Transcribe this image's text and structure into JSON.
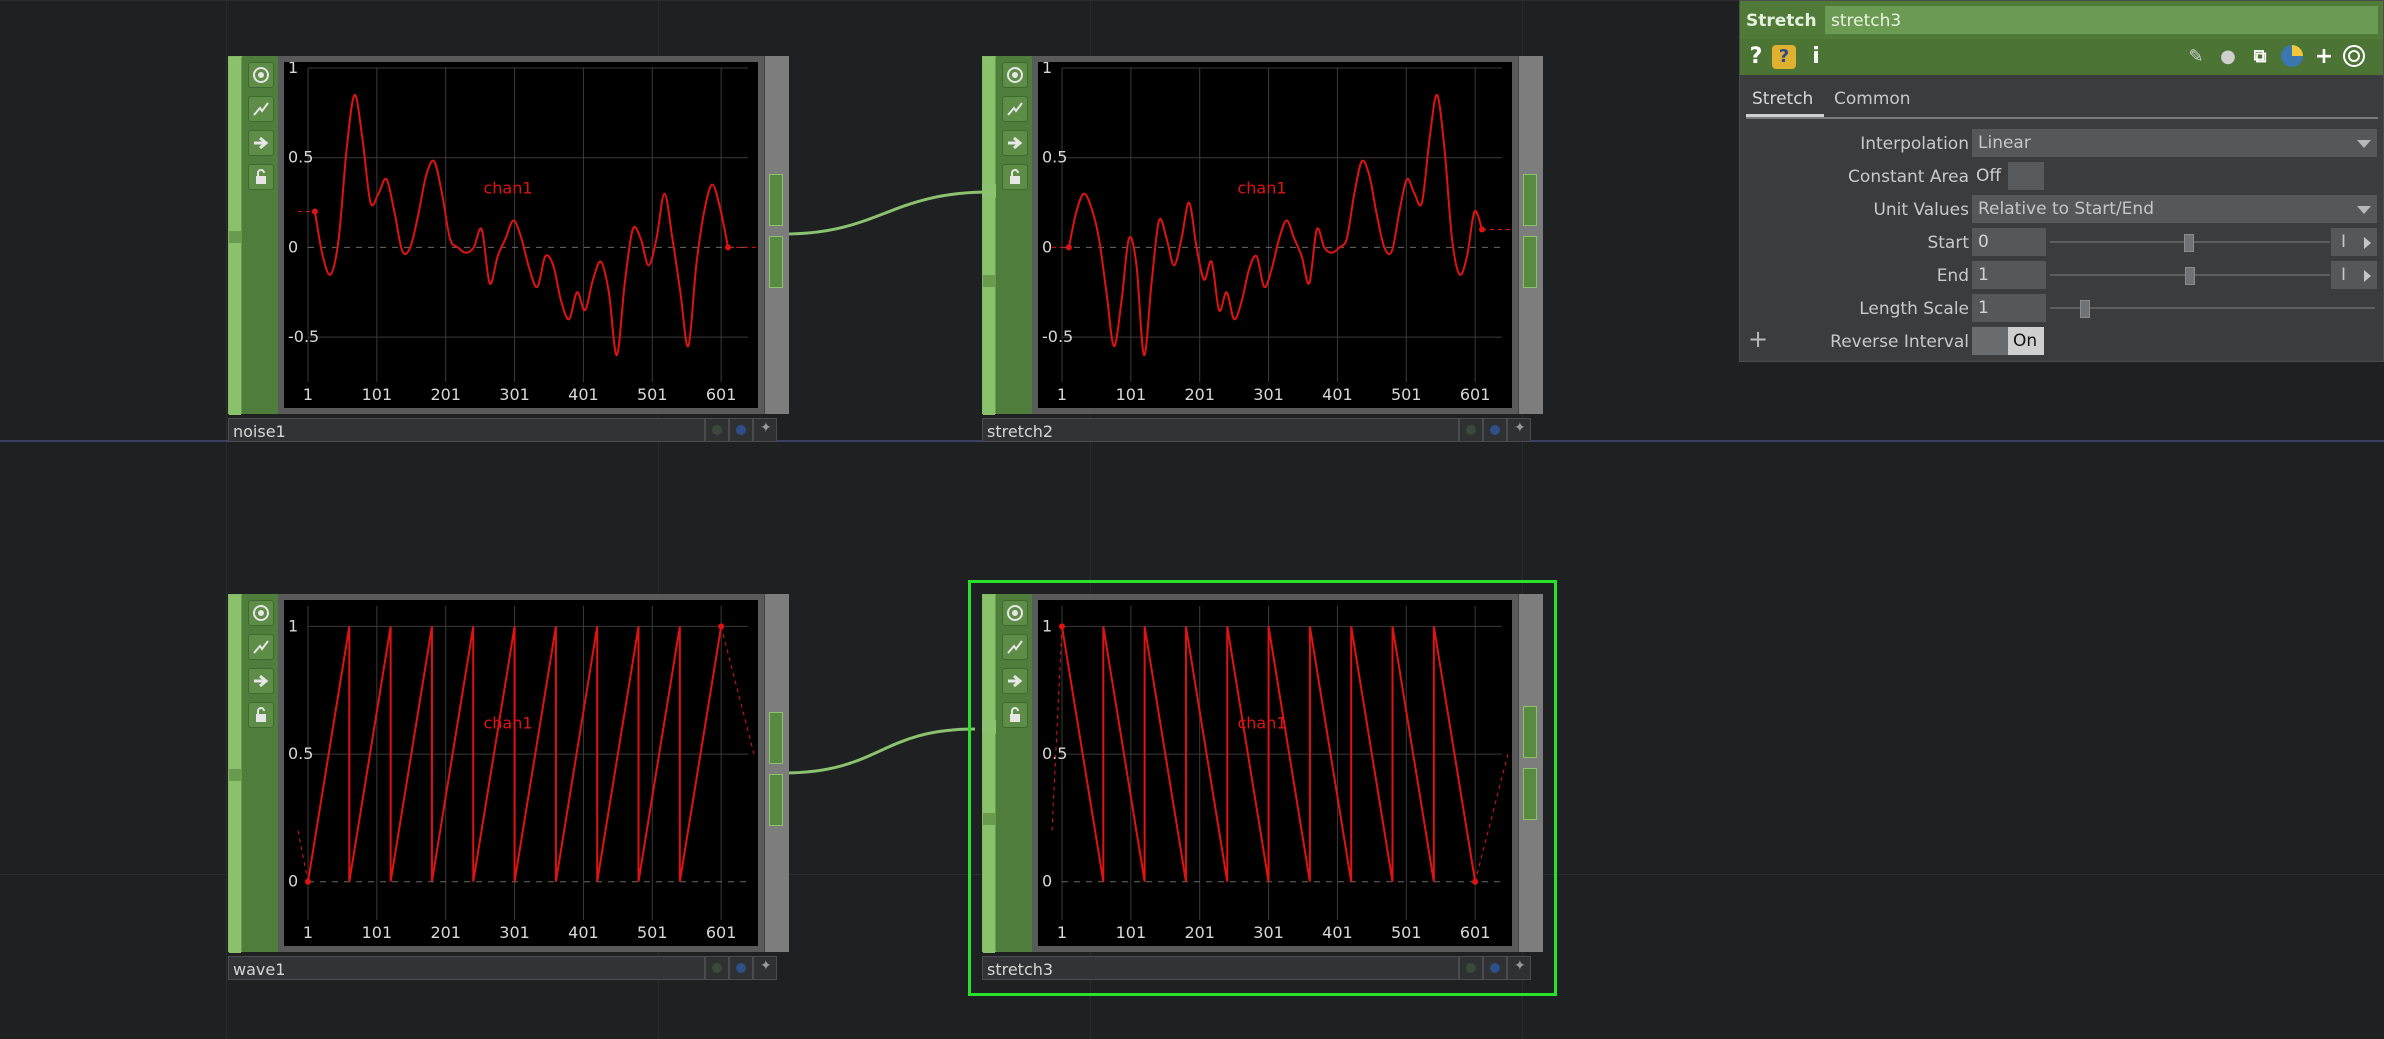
{
  "nodes": {
    "noise1": {
      "name": "noise1",
      "channel": "chan1",
      "y_ticks": [
        "1",
        "0.5",
        "0",
        "-0.5"
      ],
      "x_ticks": [
        "1",
        "101",
        "201",
        "301",
        "401",
        "501",
        "601"
      ],
      "chart_data": {
        "type": "line",
        "series": [
          {
            "name": "chan1",
            "values": [
              0.2,
              -0.05,
              -0.15,
              0.05,
              0.55,
              0.85,
              0.6,
              0.25,
              0.3,
              0.38,
              0.2,
              -0.02,
              0.0,
              0.18,
              0.4,
              0.48,
              0.3,
              0.05,
              0.0,
              -0.03,
              0.0,
              0.1,
              -0.2,
              -0.05,
              0.05,
              0.15,
              0.05,
              -0.12,
              -0.22,
              -0.05,
              -0.1,
              -0.3,
              -0.4,
              -0.25,
              -0.35,
              -0.18,
              -0.08,
              -0.25,
              -0.6,
              -0.2,
              0.1,
              0.05,
              -0.1,
              0.05,
              0.3,
              0.05,
              -0.25,
              -0.55,
              -0.1,
              0.2,
              0.35,
              0.22,
              0.0
            ]
          }
        ],
        "ylim": [
          -0.75,
          1.0
        ],
        "xlim": [
          1,
          640
        ]
      }
    },
    "stretch2": {
      "name": "stretch2",
      "channel": "chan1",
      "y_ticks": [
        "1",
        "0.5",
        "0",
        "-0.5"
      ],
      "x_ticks": [
        "1",
        "101",
        "201",
        "301",
        "401",
        "501",
        "601"
      ],
      "chart_data": {
        "type": "line",
        "series": [
          {
            "name": "chan1",
            "values": [
              0.0,
              0.2,
              0.3,
              0.22,
              0.05,
              -0.25,
              -0.55,
              -0.3,
              0.05,
              -0.1,
              -0.6,
              -0.2,
              0.15,
              0.05,
              -0.1,
              0.05,
              0.25,
              0.0,
              -0.18,
              -0.08,
              -0.35,
              -0.25,
              -0.4,
              -0.3,
              -0.12,
              -0.05,
              -0.22,
              -0.12,
              0.05,
              0.15,
              0.05,
              -0.05,
              -0.2,
              0.1,
              0.0,
              -0.03,
              0.0,
              0.05,
              0.3,
              0.48,
              0.4,
              0.18,
              0.0,
              -0.02,
              0.2,
              0.38,
              0.3,
              0.25,
              0.6,
              0.85,
              0.55,
              0.05,
              -0.15,
              -0.05,
              0.2,
              0.1
            ]
          }
        ],
        "ylim": [
          -0.75,
          1.0
        ],
        "xlim": [
          1,
          640
        ]
      }
    },
    "wave1": {
      "name": "wave1",
      "channel": "chan1",
      "y_ticks": [
        "1",
        "0.5",
        "0"
      ],
      "x_ticks": [
        "1",
        "101",
        "201",
        "301",
        "401",
        "501",
        "601"
      ],
      "chart_data": {
        "type": "line",
        "description_series": "ramp",
        "series": [
          {
            "name": "chan1",
            "ramp": "up",
            "period": 60,
            "min": 0,
            "max": 1
          }
        ],
        "ylim": [
          -0.15,
          1.08
        ],
        "xlim": [
          1,
          640
        ]
      }
    },
    "stretch3": {
      "name": "stretch3",
      "channel": "chan1",
      "y_ticks": [
        "1",
        "0.5",
        "0"
      ],
      "x_ticks": [
        "1",
        "101",
        "201",
        "301",
        "401",
        "501",
        "601"
      ],
      "chart_data": {
        "type": "line",
        "series": [
          {
            "name": "chan1",
            "ramp": "down",
            "period": 60,
            "min": 0,
            "max": 1
          }
        ],
        "ylim": [
          -0.15,
          1.08
        ],
        "xlim": [
          1,
          640
        ]
      }
    }
  },
  "params": {
    "op_type": "Stretch",
    "op_name": "stretch3",
    "tabs": [
      "Stretch",
      "Common"
    ],
    "interpolation": {
      "label": "Interpolation",
      "value": "Linear"
    },
    "constant_area": {
      "label": "Constant Area",
      "value": "Off"
    },
    "unit_values": {
      "label": "Unit Values",
      "value": "Relative to Start/End"
    },
    "start": {
      "label": "Start",
      "value": "0",
      "unit": "I"
    },
    "end": {
      "label": "End",
      "value": "1",
      "unit": "I"
    },
    "length_scale": {
      "label": "Length Scale",
      "value": "1"
    },
    "reverse_interval": {
      "label": "Reverse Interval",
      "value": "On"
    },
    "toolbar_icons": [
      "help-icon",
      "python-help-icon",
      "info-icon",
      "edit-icon",
      "comment-icon",
      "clone-icon",
      "python-icon",
      "add-icon",
      "viewer-icon"
    ]
  },
  "colors": {
    "node_green": "#6a9a4e",
    "selection": "#27e12b",
    "curve": "#e01212",
    "wire": "#8bc26f"
  }
}
